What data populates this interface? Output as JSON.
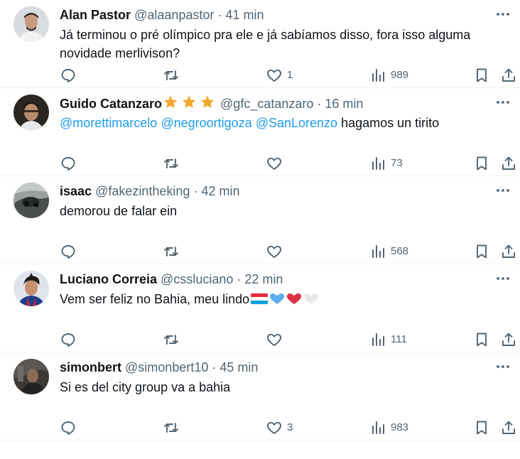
{
  "tweets": [
    {
      "name": "Alan Pastor",
      "handle": "@alaanpastor",
      "sep": "·",
      "time": "41 min",
      "body_text": "Já terminou o pré olímpico pra ele e já sabíamos disso, fora isso alguma novidade merlivison?",
      "likes": "1",
      "views": "989"
    },
    {
      "name": "Guido Catanzaro",
      "handle": "@gfc_catanzaro",
      "sep": "·",
      "time": "16 min",
      "mentions": [
        "@morettimarcelo",
        "@negroortigoza",
        "@SanLorenzo"
      ],
      "body_text": "hagamos un tirito",
      "likes": "",
      "views": "73"
    },
    {
      "name": "isaac",
      "handle": "@fakezintheking",
      "sep": "·",
      "time": "42 min",
      "body_text": "demorou de falar ein",
      "likes": "",
      "views": "568"
    },
    {
      "name": "Luciano Correia",
      "handle": "@cssluciano",
      "sep": "·",
      "time": "22 min",
      "body_text": "Vem ser feliz no Bahia, meu lindo",
      "likes": "",
      "views": "111"
    },
    {
      "name": "simonbert",
      "handle": "@simonbert10",
      "sep": "·",
      "time": "45 min",
      "body_text": "Si es del city group va a bahia",
      "likes": "3",
      "views": "983"
    }
  ],
  "icons": {
    "reply": "reply-icon",
    "retweet": "retweet-icon",
    "like": "heart-icon",
    "views": "views-icon",
    "bookmark": "bookmark-icon",
    "share": "share-icon",
    "more": "more-icon"
  },
  "colors": {
    "text": "#0f1419",
    "secondary": "#536471",
    "link": "#1d9bf0",
    "star": "#f4a72b",
    "divider": "#eff3f4"
  }
}
